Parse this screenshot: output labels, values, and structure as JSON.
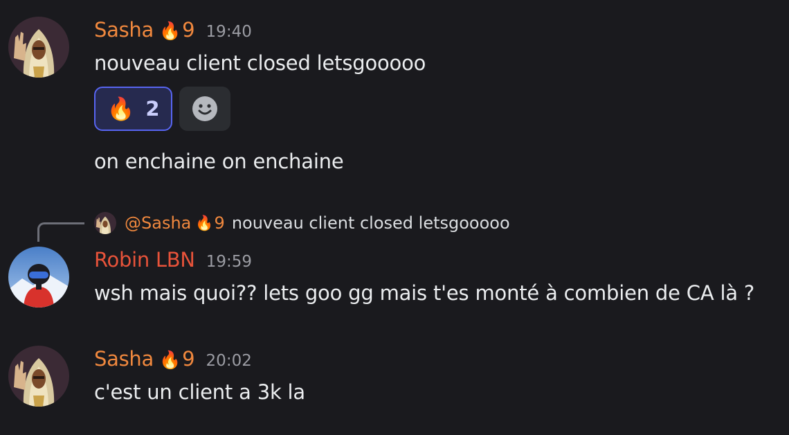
{
  "colors": {
    "background": "#1a1a1e",
    "author_orange": "#f0883e",
    "author_red": "#e8533a",
    "reaction_active_border": "#5865f2",
    "timestamp": "#9b9ca3"
  },
  "messages": [
    {
      "author": "Sasha",
      "badge_icon": "flame-icon",
      "badge_emoji": "🔥",
      "badge_count": "9",
      "time": "19:40",
      "lines": [
        "nouveau client closed letsgooooo",
        "on enchaine on enchaine"
      ],
      "reactions": [
        {
          "emoji": "🔥",
          "count": "2",
          "active": true
        }
      ],
      "add_reaction_icon": "smiley-icon"
    },
    {
      "reply": {
        "author": "@Sasha",
        "badge_emoji": "🔥",
        "badge_count": "9",
        "text": "nouveau client closed letsgooooo"
      },
      "author": "Robin LBN",
      "time": "19:59",
      "lines": [
        "wsh mais quoi?? lets goo gg  mais t'es monté à combien de CA là ?"
      ]
    },
    {
      "author": "Sasha",
      "badge_emoji": "🔥",
      "badge_count": "9",
      "time": "20:02",
      "lines": [
        "c'est un client a 3k la"
      ]
    }
  ]
}
